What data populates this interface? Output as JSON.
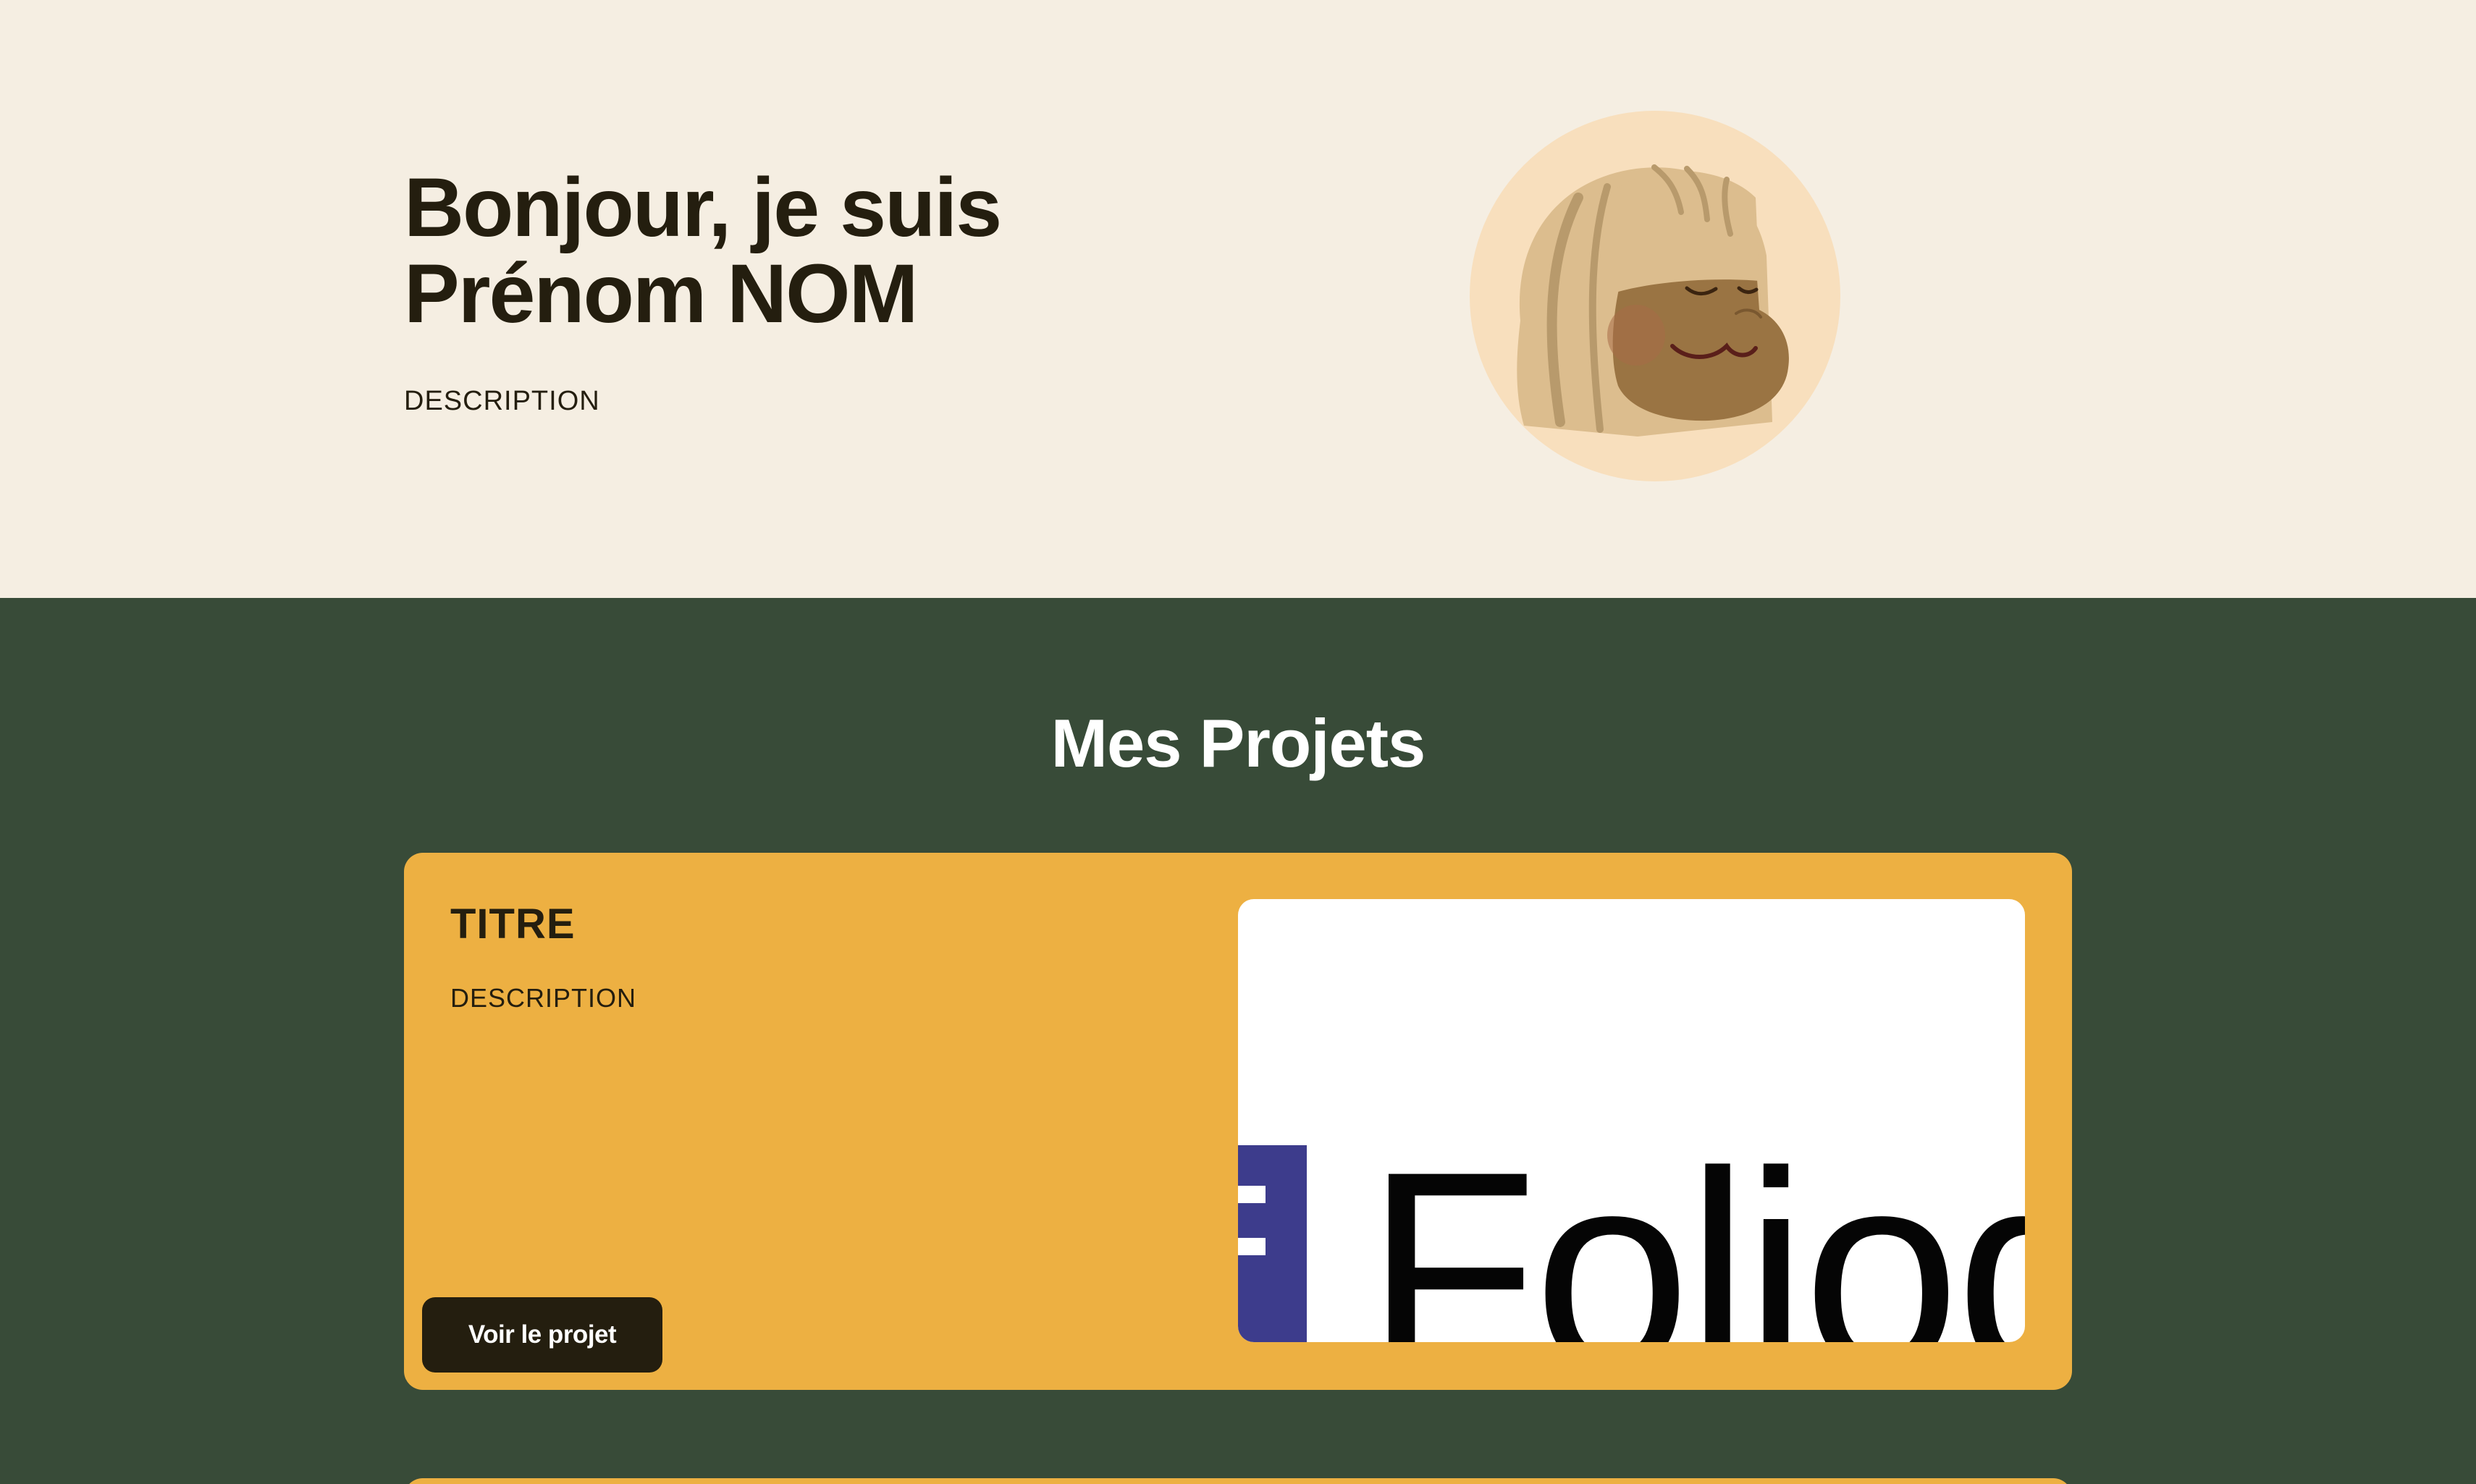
{
  "colors": {
    "hero_background": "#f5eee2",
    "projects_background": "#384b38",
    "card_background": "#edb042",
    "button_background": "#241e0f",
    "text_dark": "#241e0f",
    "avatar_background": "#f8dfbd",
    "logo_blue": "#3d3c8c"
  },
  "hero": {
    "title_line1": "Bonjour, je suis",
    "title_line2": "Prénom NOM",
    "description": "DESCRIPTION",
    "avatar_icon": "avatar-illustration"
  },
  "projects": {
    "heading": "Mes Projets",
    "items": [
      {
        "title": "TITRE",
        "description": "DESCRIPTION",
        "button_label": "Voir le projet",
        "image_text": "Foliod"
      }
    ]
  }
}
